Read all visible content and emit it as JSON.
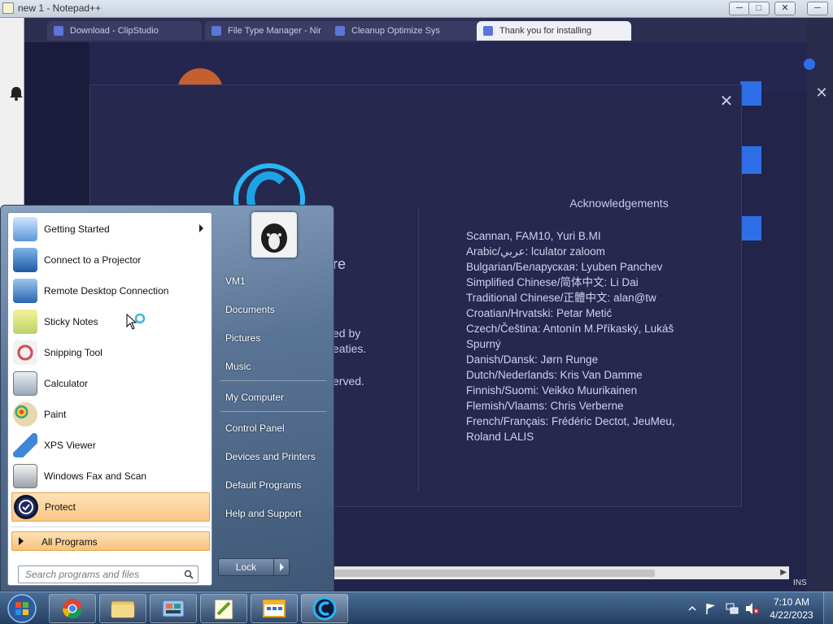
{
  "background": {
    "notepad": {
      "title": "new 1 - Notepad++"
    },
    "browser_tabs": [
      {
        "label": "Download - ClipStudio"
      },
      {
        "label": "File Type Manager - Nir"
      },
      {
        "label": "Cleanup Optimize Sys"
      },
      {
        "label": "Thank you for installing"
      }
    ],
    "colors": {
      "accent": "#2e6fe8",
      "app_bg": "#23244a",
      "dialog_bg": "#27284e"
    }
  },
  "about_dialog": {
    "fragments": [
      "re",
      "ed by",
      "eaties.",
      "erved."
    ],
    "acknowledgements_title": "Acknowledgements",
    "credits": [
      "Scannan, FAM10, Yuri B.MI",
      "Arabic/عربي: lculator zaloom",
      "Bulgarian/Беларуская: Lyuben Panchev",
      "Simplified Chinese/简体中文: Li Dai",
      "Traditional Chinese/正體中文: alan@tw",
      "Croatian/Hrvatski: Petar Metić",
      "Czech/Čeština: Antonín M.Příkaský, Lukáš",
      "Spurný",
      "Danish/Dansk: Jørn Runge",
      "Dutch/Nederlands: Kris Van Damme",
      "Finnish/Suomi: Veikko Muurikainen",
      "Flemish/Vlaams: Chris Verberne",
      "French/Français: Frédéric Dectot, JeuMeu,",
      "Roland LALIS"
    ]
  },
  "start_menu": {
    "programs": [
      {
        "label": "Getting Started",
        "icon": "getting-started-icon"
      },
      {
        "label": "Connect to a Projector",
        "icon": "projector-icon"
      },
      {
        "label": "Remote Desktop Connection",
        "icon": "remote-desktop-icon"
      },
      {
        "label": "Sticky Notes",
        "icon": "sticky-notes-icon"
      },
      {
        "label": "Snipping Tool",
        "icon": "scissors-icon"
      },
      {
        "label": "Calculator",
        "icon": "calculator-icon"
      },
      {
        "label": "Paint",
        "icon": "paint-palette-icon"
      },
      {
        "label": "XPS Viewer",
        "icon": "xps-viewer-icon"
      },
      {
        "label": "Windows Fax and Scan",
        "icon": "fax-icon"
      },
      {
        "label": "Protect",
        "icon": "protect-shield-icon"
      }
    ],
    "all_programs": "All Programs",
    "search_placeholder": "Search programs and files",
    "right_links": {
      "user": "VM1",
      "documents": "Documents",
      "pictures": "Pictures",
      "music": "Music",
      "computer": "My Computer",
      "control_panel": "Control Panel",
      "devices": "Devices and Printers",
      "defaults": "Default Programs",
      "help": "Help and Support"
    },
    "lock_label": "Lock"
  },
  "taskbar": {
    "pinned": [
      "chrome-icon",
      "explorer-folder-icon",
      "control-panel-icon",
      "notepad-plus-plus-icon",
      "calendar-app-icon",
      "ccleaner-icon"
    ],
    "time": "7:10 AM",
    "date": "4/22/2023",
    "status_ins": "INS"
  }
}
